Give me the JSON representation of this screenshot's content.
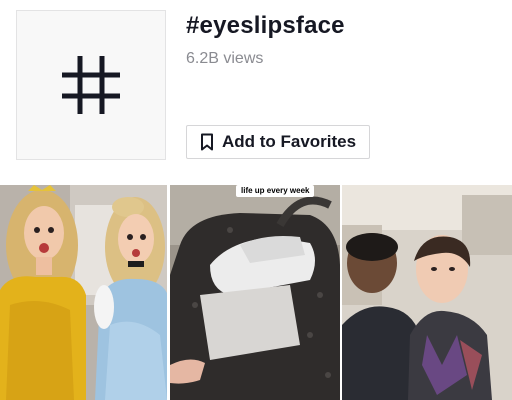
{
  "header": {
    "tag_icon": "hash-icon",
    "title": "#eyeslipsface",
    "views": "6.2B views",
    "favorite_button": {
      "icon": "bookmark-icon",
      "label": "Add to Favorites"
    }
  },
  "videos": [
    {
      "description": "two women in princess costumes"
    },
    {
      "description": "bag with sneakers",
      "caption": "life up every week"
    },
    {
      "description": "two young men in car"
    }
  ]
}
